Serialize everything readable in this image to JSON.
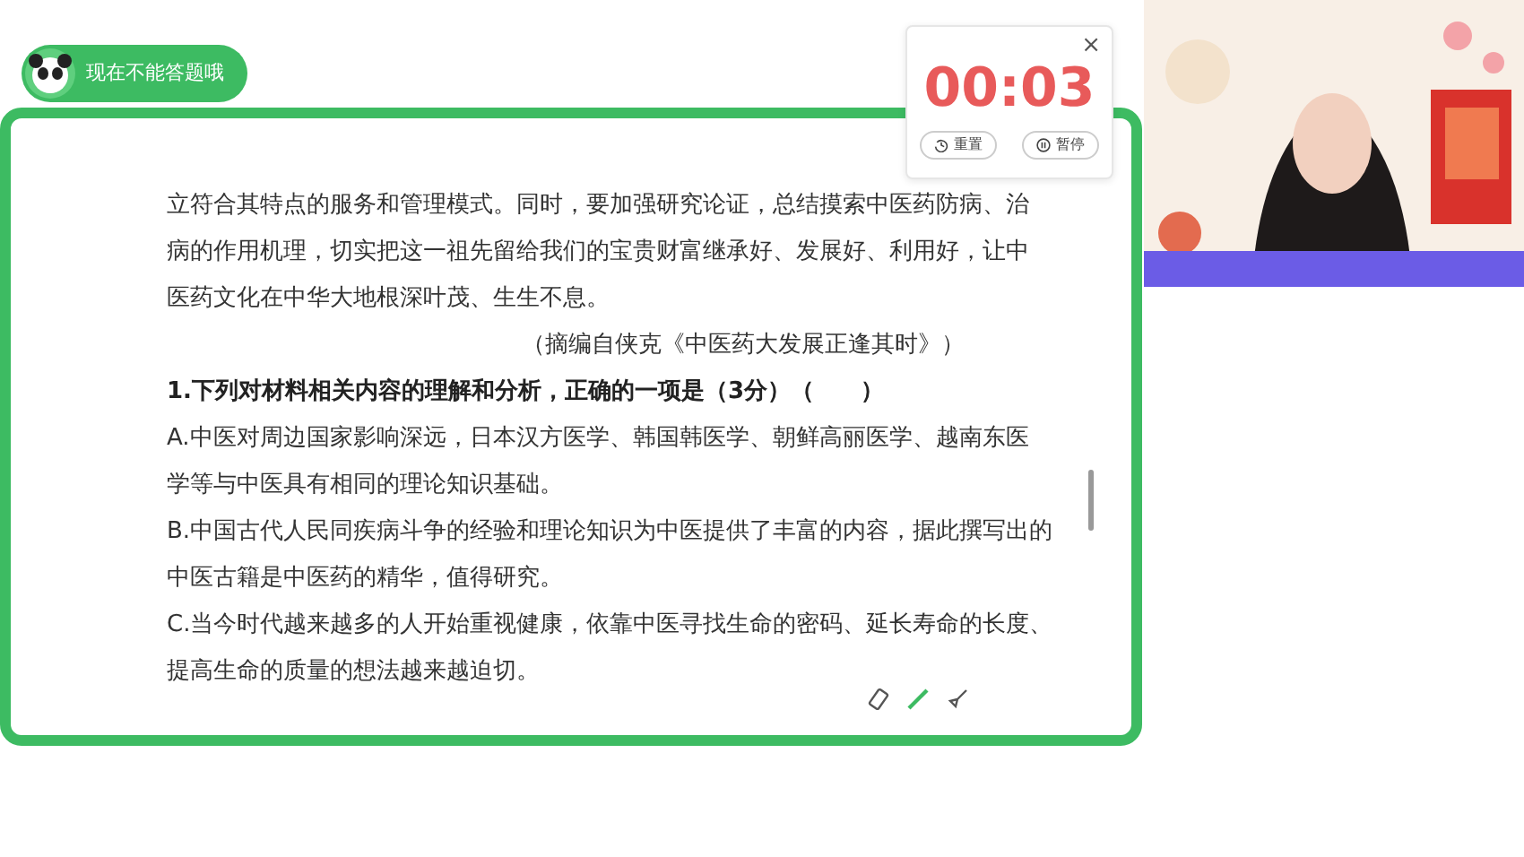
{
  "status_pill": {
    "text": "现在不能答题哦"
  },
  "passage": {
    "lines": [
      "立符合其特点的服务和管理模式。同时，要加强研究论证，总结摸索中医药防病、治",
      "病的作用机理，切实把这一祖先留给我们的宝贵财富继承好、发展好、利用好，让中",
      "医药文化在中华大地根深叶茂、生生不息。"
    ],
    "source": "（摘编自侠克《中医药大发展正逢其时》）"
  },
  "question": {
    "title": "1.下列对材料相关内容的理解和分析，正确的一项是（3分）（　　）",
    "options": [
      {
        "lines": [
          "A.中医对周边国家影响深远，日本汉方医学、韩国韩医学、朝鲜高丽医学、越南东医",
          "学等与中医具有相同的理论知识基础。"
        ]
      },
      {
        "lines": [
          "B.中国古代人民同疾病斗争的经验和理论知识为中医提供了丰富的内容，据此撰写出的",
          "中医古籍是中医药的精华，值得研究。"
        ]
      },
      {
        "lines": [
          "C.当今时代越来越多的人开始重视健康，依靠中医寻找生命的密码、延长寿命的长度、",
          "提高生命的质量的想法越来越迫切。"
        ]
      }
    ]
  },
  "timer": {
    "close": "×",
    "time": "00:03",
    "buttons": [
      {
        "kind": "reset",
        "label": "重置"
      },
      {
        "kind": "pause",
        "label": "暂停"
      }
    ]
  }
}
